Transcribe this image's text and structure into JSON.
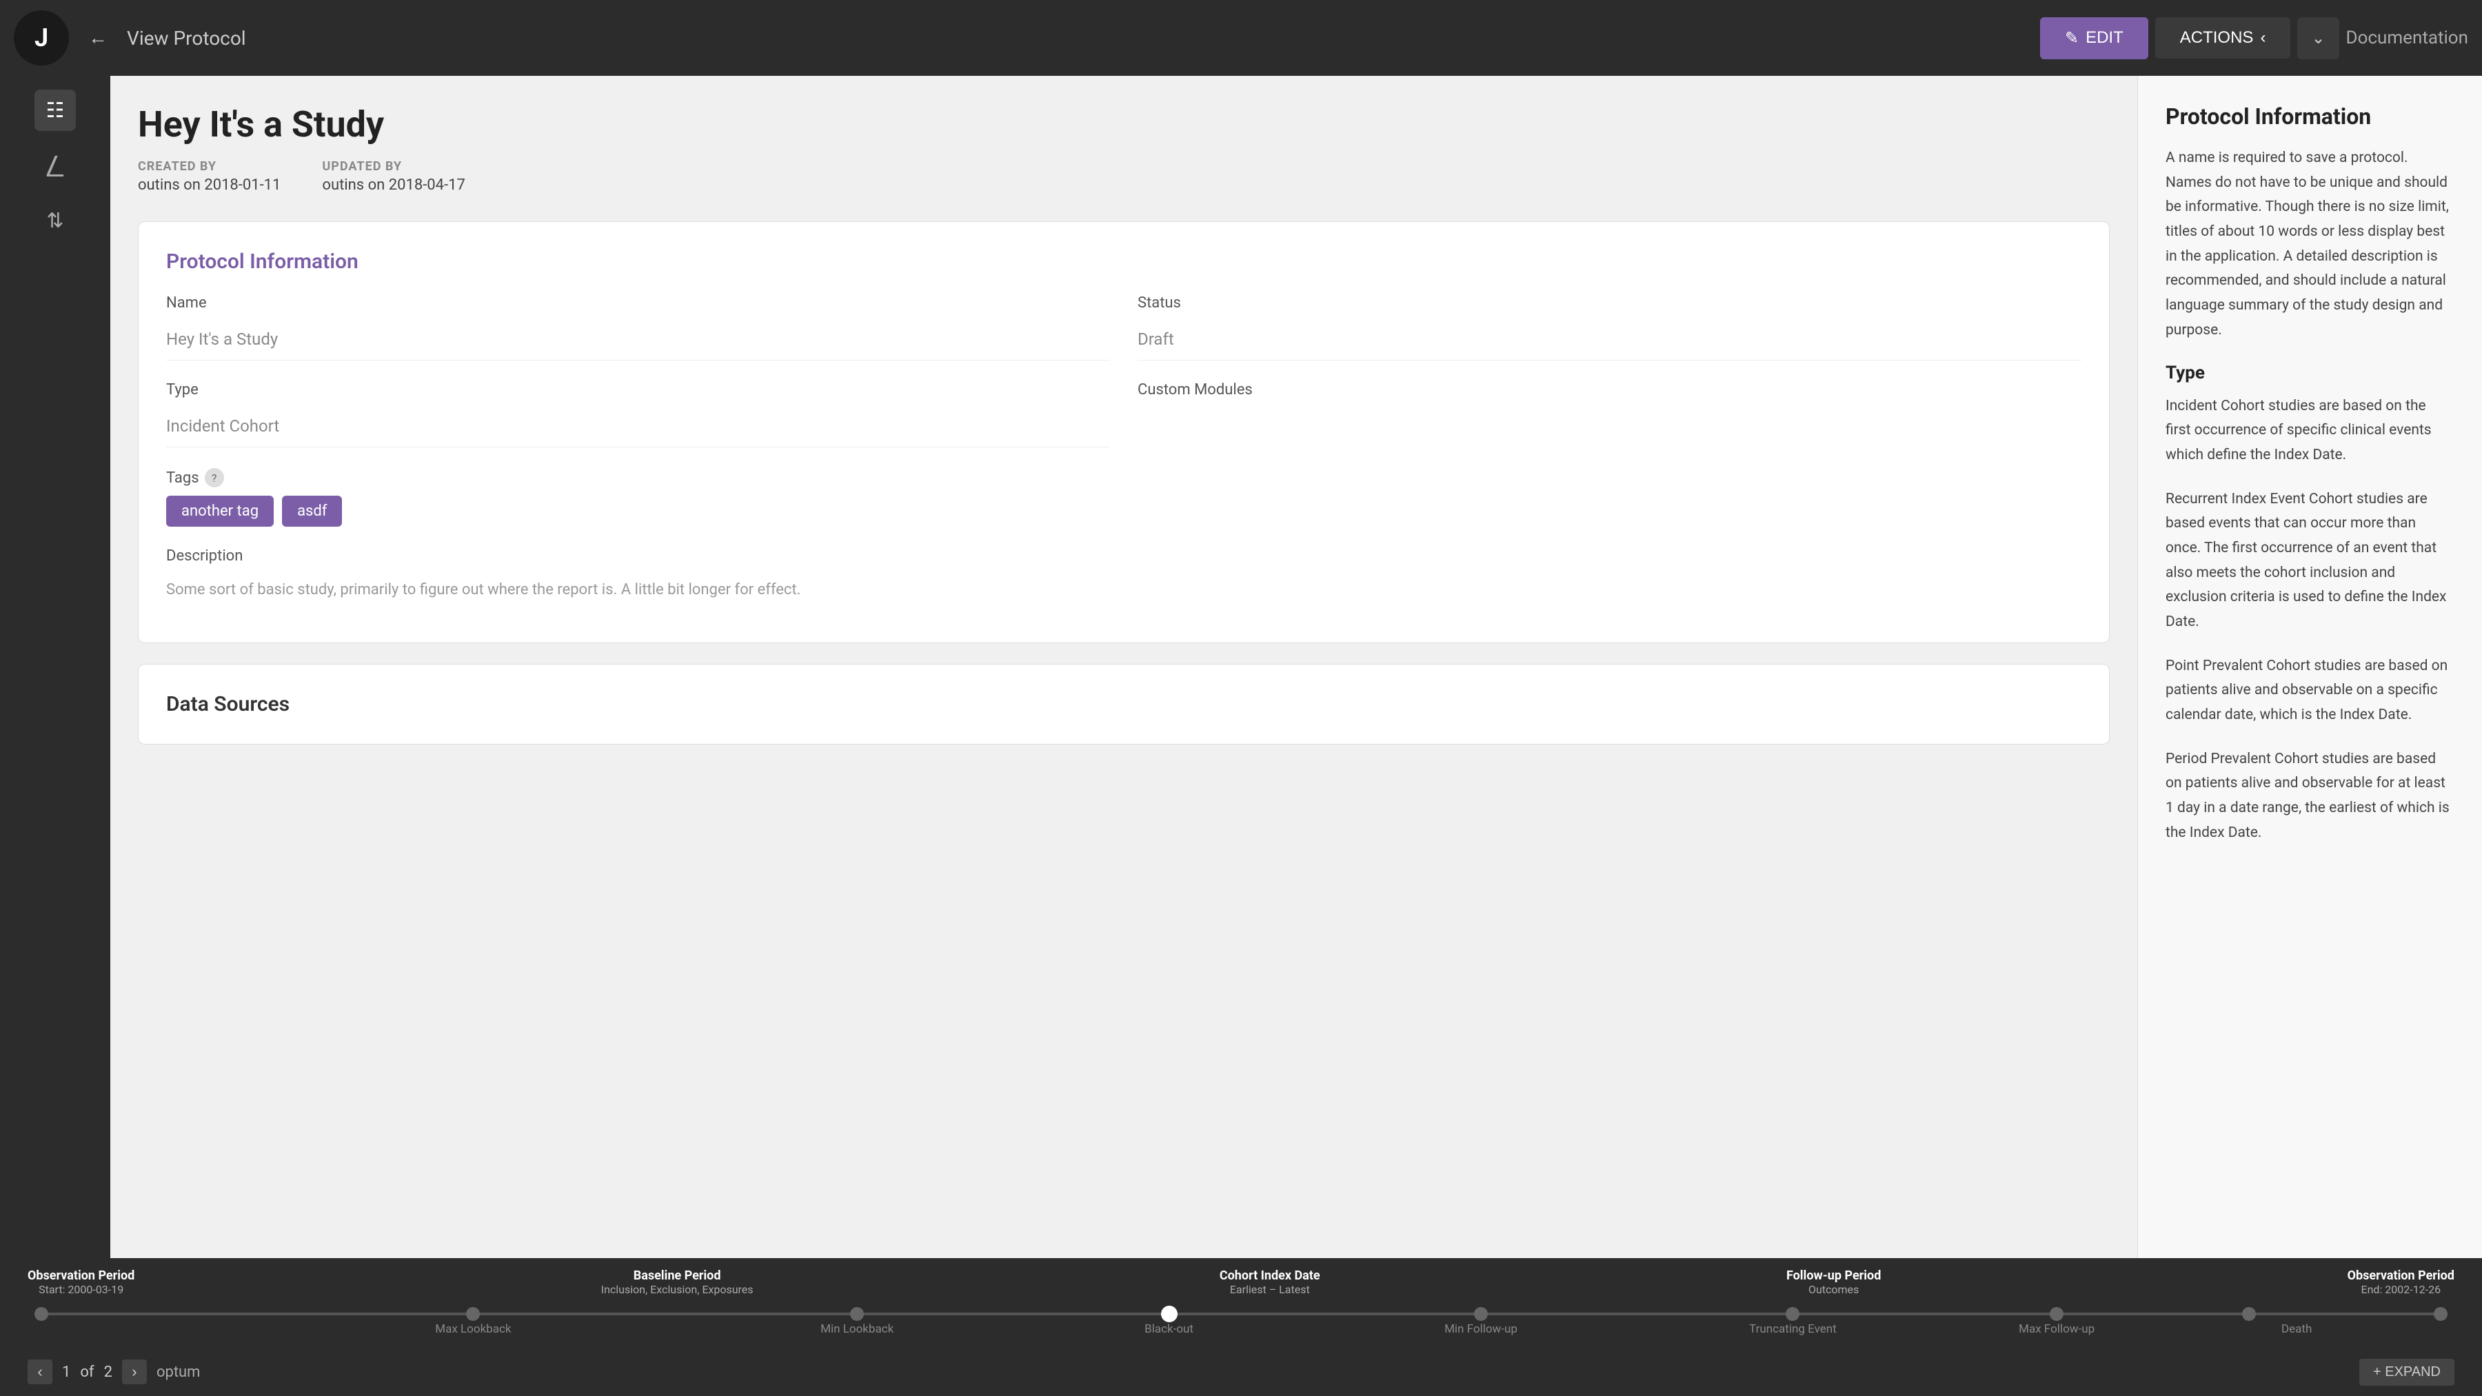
{
  "topbar": {
    "page_title": "View Protocol",
    "edit_label": "EDIT",
    "actions_label": "ACTIONS",
    "documentation_label": "Documentation"
  },
  "sidebar": {
    "icons": [
      {
        "name": "grid-icon",
        "symbol": "▦"
      },
      {
        "name": "code-branch-icon",
        "symbol": "⑂"
      },
      {
        "name": "sort-icon",
        "symbol": "⇅"
      }
    ]
  },
  "study": {
    "title": "Hey It's a Study",
    "created_by_label": "CREATED BY",
    "created_by": "outins on 2018-01-11",
    "updated_by_label": "UPDATED BY",
    "updated_by": "outins on 2018-04-17"
  },
  "protocol_info": {
    "section_title": "Protocol Information",
    "name_label": "Name",
    "name_value": "Hey It's a Study",
    "status_label": "Status",
    "status_value": "Draft",
    "type_label": "Type",
    "type_value": "Incident Cohort",
    "custom_modules_label": "Custom Modules",
    "tags_label": "Tags",
    "tags": [
      {
        "label": "another tag"
      },
      {
        "label": "asdf"
      }
    ],
    "description_label": "Description",
    "description_value": "Some sort of basic study, primarily to figure out where the report is. A little bit longer for effect."
  },
  "data_sources": {
    "section_title": "Data Sources"
  },
  "right_panel": {
    "title": "Protocol Information",
    "description": "A name is required to save a protocol. Names do not have to be unique and should be informative. Though there is no size limit, titles of about 10 words or less display best in the application. A detailed description is recommended, and should include a natural language summary of the study design and purpose.",
    "type_title": "Type",
    "type_incident": "Incident Cohort studies are based on the first occurrence of specific clinical events which define the Index Date.",
    "type_recurrent": "Recurrent Index Event Cohort studies are based events that can occur more than once. The first occurrence of an event that also meets the cohort inclusion and exclusion criteria is used to define the Index Date.",
    "type_point": "Point Prevalent Cohort studies are based on patients alive and observable on a specific calendar date, which is the Index Date.",
    "type_period": "Period Prevalent Cohort studies are based on patients alive and observable for at least 1 day in a date range, the earliest of which is the Index Date."
  },
  "timeline": {
    "sections": [
      {
        "title": "Observation Period",
        "sub": "Start: 2000-03-19",
        "align": "left"
      },
      {
        "title": "Baseline Period",
        "sub": "Inclusion, Exclusion, Exposures",
        "align": "center"
      },
      {
        "title": "Cohort Index Date",
        "sub": "Earliest – Latest",
        "align": "center"
      },
      {
        "title": "Follow-up Period",
        "sub": "Outcomes",
        "align": "center"
      },
      {
        "title": "Observation Period",
        "sub": "End: 2002-12-26",
        "align": "right"
      }
    ],
    "markers": [
      "Max Lookback",
      "Min Lookback",
      "Black-out",
      "Min Follow-up",
      "Truncating Event",
      "Max Follow-up",
      "Death"
    ]
  },
  "bottombar": {
    "page_current": "1",
    "page_total": "2",
    "page_label": "of",
    "data_source": "optum",
    "expand_label": "+ EXPAND"
  }
}
